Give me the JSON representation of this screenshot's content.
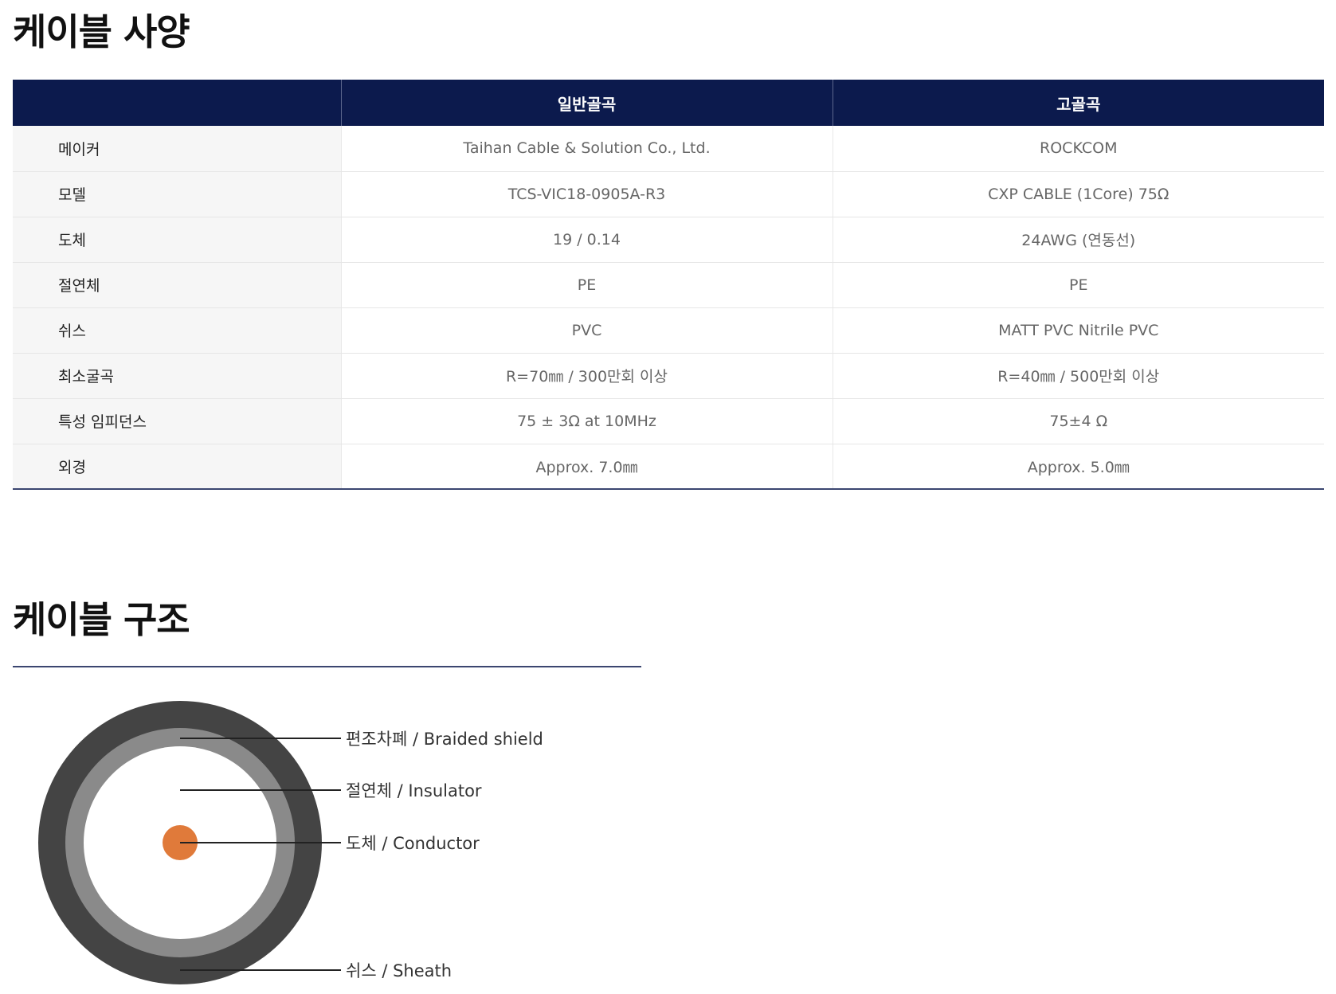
{
  "spec_section": {
    "title": "케이블 사양",
    "table": {
      "headers": [
        "",
        "일반골곡",
        "고골곡"
      ],
      "rows": [
        {
          "label": "메이커",
          "general": "Taihan Cable & Solution Co., Ltd.",
          "high": "ROCKCOM"
        },
        {
          "label": "모델",
          "general": "TCS-VIC18-0905A-R3",
          "high": "CXP CABLE (1Core) 75Ω"
        },
        {
          "label": "도체",
          "general": "19 / 0.14",
          "high": "24AWG (연동선)"
        },
        {
          "label": "절연체",
          "general": "PE",
          "high": "PE"
        },
        {
          "label": "쉬스",
          "general": "PVC",
          "high": "MATT PVC Nitrile PVC"
        },
        {
          "label": "최소굴곡",
          "general": "R=70㎜ / 300만회 이상",
          "high": "R=40㎜ / 500만회 이상"
        },
        {
          "label": "특성 임피던스",
          "general": "75 ± 3Ω at 10MHz",
          "high": "75±4 Ω"
        },
        {
          "label": "외경",
          "general": "Approx. 7.0㎜",
          "high": "Approx. 5.0㎜"
        }
      ]
    }
  },
  "structure_section": {
    "title": "케이블 구조",
    "labels": {
      "braided_shield": "편조차폐 / Braided shield",
      "insulator": "절연체 / Insulator",
      "conductor": "도체 / Conductor",
      "sheath": "쉬스 / Sheath"
    },
    "colors": {
      "sheath": "#444444",
      "braided_shield": "#8a8a8a",
      "insulator": "#ffffff",
      "conductor": "#e07a3a",
      "header_bg": "#0c1a4d"
    }
  }
}
